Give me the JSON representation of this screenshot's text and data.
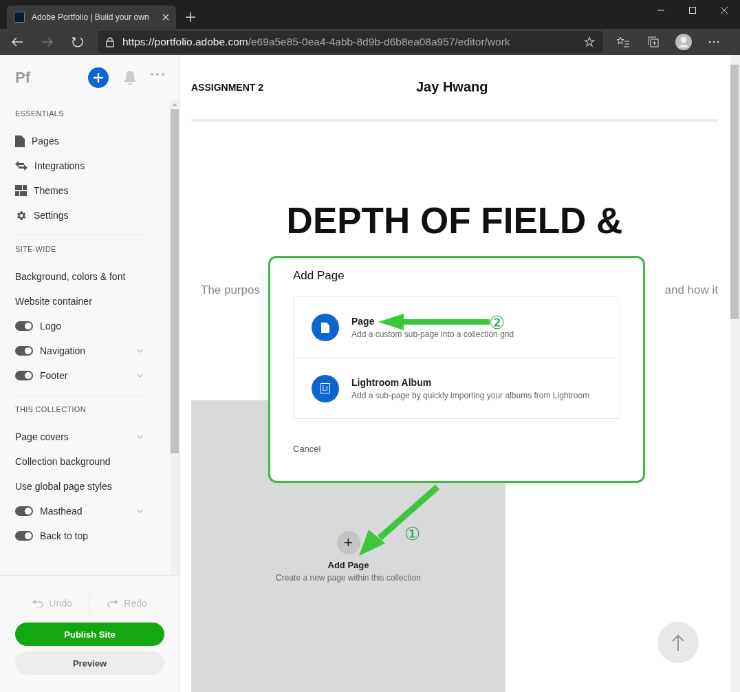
{
  "browser": {
    "tab_title": "Adobe Portfolio | Build your own",
    "url_host": "https://portfolio.adobe.com",
    "url_path": "/e69a5e85-0ea4-4abb-8d9b-d6b8ea08a957/editor/work"
  },
  "sidebar": {
    "logo": "Pf",
    "sections": [
      {
        "heading": "ESSENTIALS",
        "items": [
          {
            "kind": "icon",
            "label": "Pages"
          },
          {
            "kind": "icon",
            "label": "Integrations"
          },
          {
            "kind": "icon",
            "label": "Themes"
          },
          {
            "kind": "icon",
            "label": "Settings"
          }
        ]
      },
      {
        "heading": "SITE-WIDE",
        "items": [
          {
            "kind": "link",
            "label": "Background, colors & font",
            "chevron": false
          },
          {
            "kind": "link",
            "label": "Website container",
            "chevron": false
          },
          {
            "kind": "toggle",
            "label": "Logo",
            "on": true,
            "chevron": false
          },
          {
            "kind": "toggle",
            "label": "Navigation",
            "on": true,
            "chevron": true
          },
          {
            "kind": "toggle",
            "label": "Footer",
            "on": true,
            "chevron": true
          }
        ]
      },
      {
        "heading": "THIS COLLECTION",
        "items": [
          {
            "kind": "link",
            "label": "Page covers",
            "chevron": true
          },
          {
            "kind": "link",
            "label": "Collection background",
            "chevron": false
          },
          {
            "kind": "link",
            "label": "Use global page styles",
            "chevron": false
          },
          {
            "kind": "toggle",
            "label": "Masthead",
            "on": true,
            "chevron": true
          },
          {
            "kind": "toggle",
            "label": "Back to top",
            "on": true,
            "chevron": false
          }
        ]
      }
    ],
    "undo": {
      "label": "Undo",
      "disabled": true
    },
    "redo": {
      "label": "Redo",
      "disabled": true
    },
    "publish": "Publish Site",
    "preview": "Preview"
  },
  "page": {
    "section": "ASSIGNMENT 2",
    "author": "Jay Hwang",
    "title_lines": [
      "DEPTH OF FIELD &"
    ],
    "intro_left": "The purpos",
    "intro_right": "and how it",
    "add_page": {
      "symbol": "+",
      "title": "Add Page",
      "subtitle": "Create a new page within this collection"
    }
  },
  "dialog": {
    "title": "Add Page",
    "options": [
      {
        "kind": "page",
        "title": "Page",
        "description": "Add a custom sub-page into a collection grid"
      },
      {
        "kind": "lightroom",
        "icon_text": "Lr",
        "title": "Lightroom Album",
        "description": "Add a sub-page by quickly importing your albums from Lightroom"
      }
    ],
    "cancel": "Cancel"
  },
  "annotations": [
    {
      "number": "①"
    },
    {
      "number": "②"
    }
  ]
}
